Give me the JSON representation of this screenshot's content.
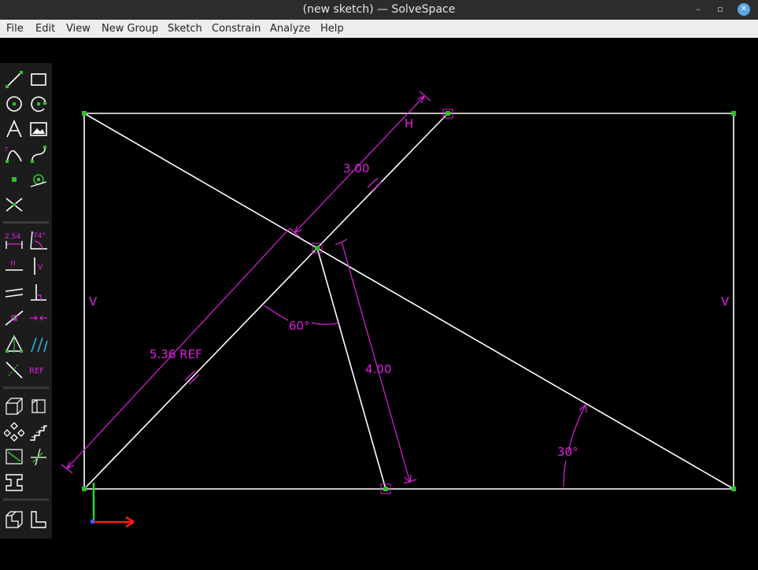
{
  "window": {
    "title": "(new sketch) — SolveSpace",
    "controls": {
      "minimize": "–",
      "maximize": "▫",
      "close": "✕"
    }
  },
  "menu": [
    "File",
    "Edit",
    "View",
    "New Group",
    "Sketch",
    "Constrain",
    "Analyze",
    "Help"
  ],
  "toolbar": {
    "dimension_label": "2.54",
    "angle_label": "74°",
    "horizontal_label": "H",
    "vertical_label": "V",
    "reference_label": "REF"
  },
  "sketch": {
    "constraints": {
      "horizontal_top": "H",
      "vertical_left": "V",
      "vertical_right": "V",
      "length_top_segment": "3.00",
      "length_reference": "5.36  REF",
      "length_lower_segment": "4.00",
      "angle_center": "60°",
      "angle_right": "30°"
    }
  },
  "colors": {
    "geometry": "#ffffff",
    "constraint": "#e020e0",
    "point": "#2ec02e",
    "axis_x": "#ff1a1a",
    "axis_y": "#22dd22",
    "axis_z": "#3a5cff"
  }
}
